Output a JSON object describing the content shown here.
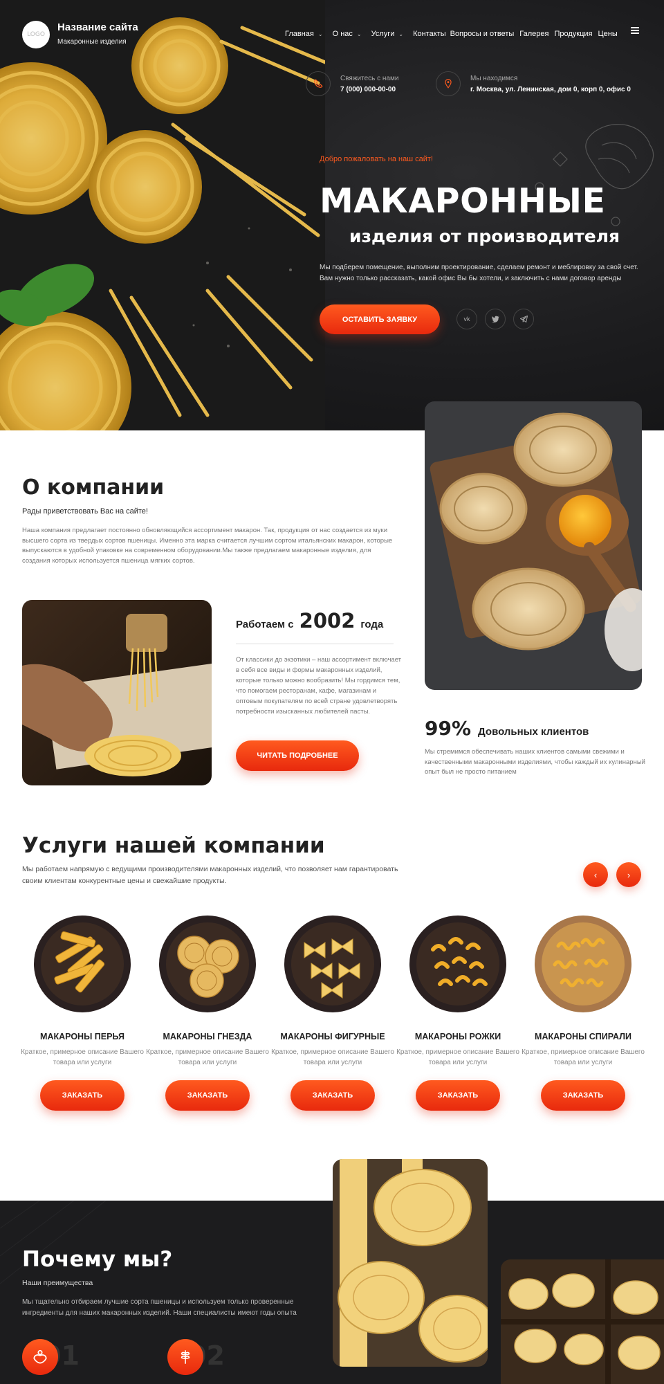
{
  "header": {
    "logo_text": "LOGO",
    "site_name": "Название сайта",
    "site_subtitle": "Макаронные изделия",
    "nav": [
      {
        "label": "Главная",
        "dropdown": true
      },
      {
        "label": "О нас",
        "dropdown": true
      },
      {
        "label": "Услуги",
        "dropdown": true
      },
      {
        "label": "Контакты",
        "dropdown": false
      },
      {
        "label": "Вопросы и ответы",
        "dropdown": false
      },
      {
        "label": "Галерея",
        "dropdown": false
      },
      {
        "label": "Продукция",
        "dropdown": false
      },
      {
        "label": "Цены",
        "dropdown": false
      }
    ],
    "contact_phone": {
      "label": "Свяжитесь с нами",
      "value": "7 (000) 000-00-00",
      "icon": "phone-icon"
    },
    "contact_address": {
      "label": "Мы находимся",
      "value": "г. Москва, ул. Ленинская, дом 0, корп 0, офис 0",
      "icon": "location-icon"
    }
  },
  "hero": {
    "welcome": "Добро пожаловать на наш сайт!",
    "title_line1": "МАКАРОННЫЕ",
    "title_line2": "изделия от производителя",
    "description": "Мы подберем помещение, выполним проектирование, сделаем ремонт и меблировку за свой счет. Вам нужно только рассказать, какой офис Вы бы хотели, и заключить с нами договор аренды",
    "cta": "ОСТАВИТЬ ЗАЯВКУ",
    "social": [
      "vk-icon",
      "twitter-icon",
      "telegram-icon"
    ]
  },
  "about": {
    "title": "О компании",
    "subtitle": "Рады приветствовать Вас на сайте!",
    "text": "Наша компания предлагает постоянно обновляющийся ассортимент макарон. Так, продукция от нас создается из муки высшего сорта из твердых сортов пшеницы. Именно эта марка считается лучшим сортом итальянских макарон, которые выпускаются в удобной упаковке на современном оборудовании.Мы также предлагаем макаронные изделия, для создания которых используется пшеница мягких сортов.",
    "since_prefix": "Работаем с",
    "since_year": "2002",
    "since_suffix": "года",
    "since_text": "От классики до экзотики – наш ассортимент включает в себя все виды и формы макаронных изделий, которые только можно вообразить! Мы гордимся тем, что помогаем ресторанам, кафе, магазинам и оптовым покупателям по всей стране удовлетворять потребности изысканных любителей пасты.",
    "more_button": "ЧИТАТЬ ПОДРОБНЕЕ",
    "stat_value": "99%",
    "stat_label": "Довольных клиентов",
    "stat_text": "Мы стремимся обеспечивать наших клиентов самыми свежими и качественными макаронными изделиями, чтобы каждый их кулинарный опыт был не просто питанием"
  },
  "services": {
    "title": "Услуги нашей компании",
    "description": "Мы работаем напрямую с ведущими производителями макаронных изделий, что позволяет нам гарантировать своим клиентам конкурентные цены и свежайшие продукты.",
    "prev_label": "‹",
    "next_label": "›",
    "items": [
      {
        "name": "МАКАРОНЫ ПЕРЬЯ",
        "desc": "Краткое, примерное описание Вашего товара или услуги",
        "button": "ЗАКАЗАТЬ"
      },
      {
        "name": "МАКАРОНЫ ГНЕЗДА",
        "desc": "Краткое, примерное описание Вашего товара или услуги",
        "button": "ЗАКАЗАТЬ"
      },
      {
        "name": "МАКАРОНЫ ФИГУРНЫЕ",
        "desc": "Краткое, примерное описание Вашего товара или услуги",
        "button": "ЗАКАЗАТЬ"
      },
      {
        "name": "МАКАРОНЫ РОЖКИ",
        "desc": "Краткое, примерное описание Вашего товара или услуги",
        "button": "ЗАКАЗАТЬ"
      },
      {
        "name": "МАКАРОНЫ СПИРАЛИ",
        "desc": "Краткое, примерное описание Вашего товара или услуги",
        "button": "ЗАКАЗАТЬ"
      }
    ]
  },
  "why": {
    "title": "Почему мы?",
    "subtitle": "Наши преимущества",
    "text": "Мы тщательно отбираем лучшие сорта пшеницы и используем только проверенные ингредиенты для наших макаронных изделий. Наши специалисты имеют годы опыта",
    "advantages": [
      {
        "num": "01",
        "icon": "hands-icon"
      },
      {
        "num": "02",
        "icon": "wheat-icon"
      }
    ]
  },
  "colors": {
    "accent": "#ff4a1a",
    "dark": "#1c1c1e",
    "text": "#222222",
    "muted": "#777777"
  }
}
